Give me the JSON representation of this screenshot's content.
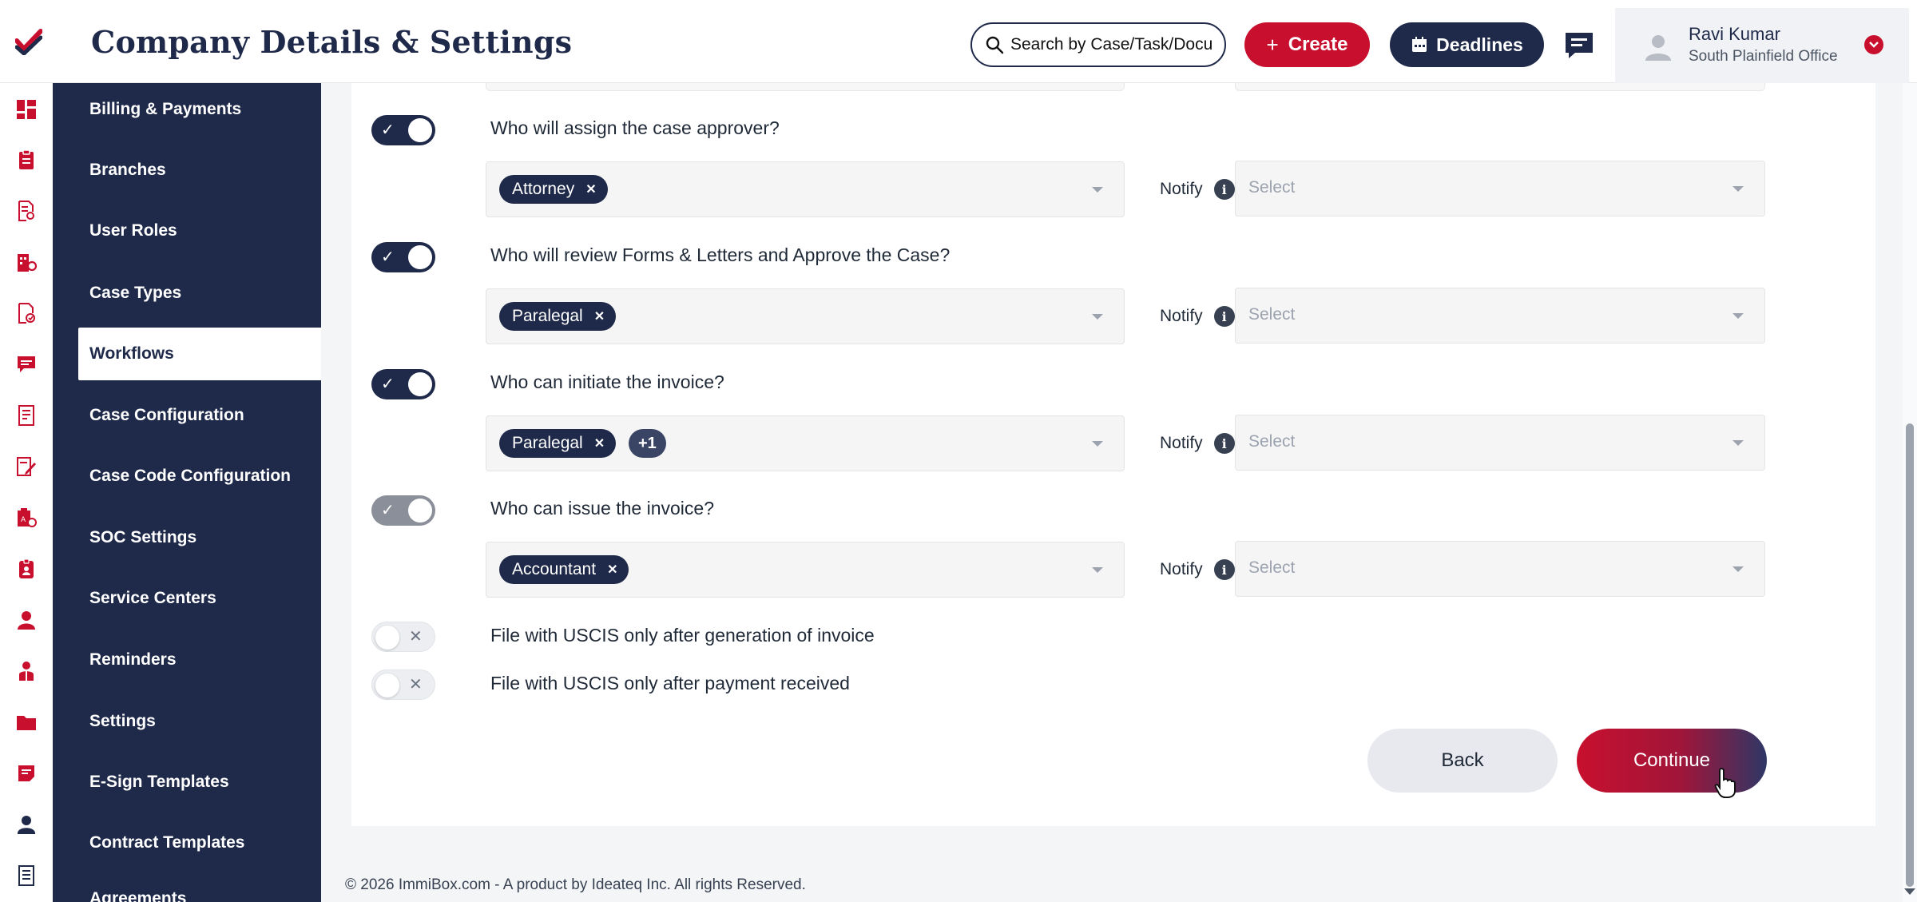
{
  "header": {
    "title": "Company Details & Settings",
    "search_placeholder": "Search by Case/Task/Docu",
    "create_label": "Create",
    "deadlines_label": "Deadlines",
    "user_name": "Ravi Kumar",
    "user_office": "South Plainfield Office"
  },
  "rail_icons": [
    "dashboard-icon",
    "clipboard-icon",
    "document-search-icon",
    "building-icon",
    "document-check-icon",
    "chat-icon",
    "report-icon",
    "edit-document-icon",
    "forms-icon",
    "badge-icon",
    "user-icon",
    "person-icon",
    "folder-icon",
    "note-icon",
    "profile-icon",
    "file-icon"
  ],
  "sidebar": {
    "items": [
      {
        "label": "Billing & Payments",
        "active": false
      },
      {
        "label": "Branches",
        "active": false
      },
      {
        "label": "User Roles",
        "active": false
      },
      {
        "label": "Case Types",
        "active": false
      },
      {
        "label": "Workflows",
        "active": true
      },
      {
        "label": "Case Configuration",
        "active": false
      },
      {
        "label": "Case Code Configuration",
        "active": false
      },
      {
        "label": "SOC Settings",
        "active": false
      },
      {
        "label": "Service Centers",
        "active": false
      },
      {
        "label": "Reminders",
        "active": false
      },
      {
        "label": "Settings",
        "active": false
      },
      {
        "label": "E-Sign Templates",
        "active": false
      },
      {
        "label": "Contract Templates",
        "active": false
      },
      {
        "label": "Agreements",
        "active": false
      }
    ]
  },
  "workflow": {
    "notify_label": "Notify",
    "select_placeholder": "Select",
    "questions": [
      {
        "label": "Who will assign the case approver?",
        "toggle": "on",
        "chips": [
          "Attorney"
        ],
        "more": ""
      },
      {
        "label": "Who will review Forms & Letters and Approve the Case?",
        "toggle": "on",
        "chips": [
          "Paralegal"
        ],
        "more": ""
      },
      {
        "label": "Who can initiate the invoice?",
        "toggle": "on",
        "chips": [
          "Paralegal"
        ],
        "more": "+1"
      },
      {
        "label": "Who can issue the invoice?",
        "toggle": "disabled",
        "chips": [
          "Accountant"
        ],
        "more": ""
      }
    ],
    "options": [
      {
        "label": "File with USCIS only after generation of invoice",
        "toggle": "off"
      },
      {
        "label": "File with USCIS only after payment received",
        "toggle": "off"
      }
    ]
  },
  "actions": {
    "back_label": "Back",
    "continue_label": "Continue"
  },
  "footer": {
    "text": "© 2026 ImmiBox.com - A product by Ideateq Inc. All rights Reserved."
  },
  "colors": {
    "navy": "#1f2a4a",
    "red": "#c8102e",
    "panel": "#f4f5f7"
  }
}
